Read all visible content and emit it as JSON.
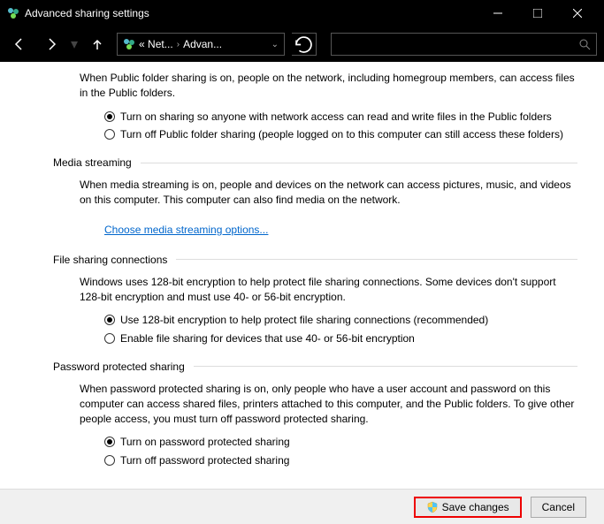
{
  "window": {
    "title": "Advanced sharing settings"
  },
  "breadcrumb": {
    "part1": "« Net...",
    "part2": "Advan..."
  },
  "sections": {
    "public_folder": {
      "intro": "When Public folder sharing is on, people on the network, including homegroup members, can access files in the Public folders.",
      "option_on": "Turn on sharing so anyone with network access can read and write files in the Public folders",
      "option_off": "Turn off Public folder sharing (people logged on to this computer can still access these folders)"
    },
    "media_streaming": {
      "title": "Media streaming",
      "intro": "When media streaming is on, people and devices on the network can access pictures, music, and videos on this computer. This computer can also find media on the network.",
      "link": "Choose media streaming options..."
    },
    "file_sharing": {
      "title": "File sharing connections",
      "intro": "Windows uses 128-bit encryption to help protect file sharing connections. Some devices don't support 128-bit encryption and must use 40- or 56-bit encryption.",
      "option_128": "Use 128-bit encryption to help protect file sharing connections (recommended)",
      "option_40": "Enable file sharing for devices that use 40- or 56-bit encryption"
    },
    "password": {
      "title": "Password protected sharing",
      "intro": "When password protected sharing is on, only people who have a user account and password on this computer can access shared files, printers attached to this computer, and the Public folders. To give other people access, you must turn off password protected sharing.",
      "option_on": "Turn on password protected sharing",
      "option_off": "Turn off password protected sharing"
    }
  },
  "footer": {
    "save": "Save changes",
    "cancel": "Cancel"
  }
}
